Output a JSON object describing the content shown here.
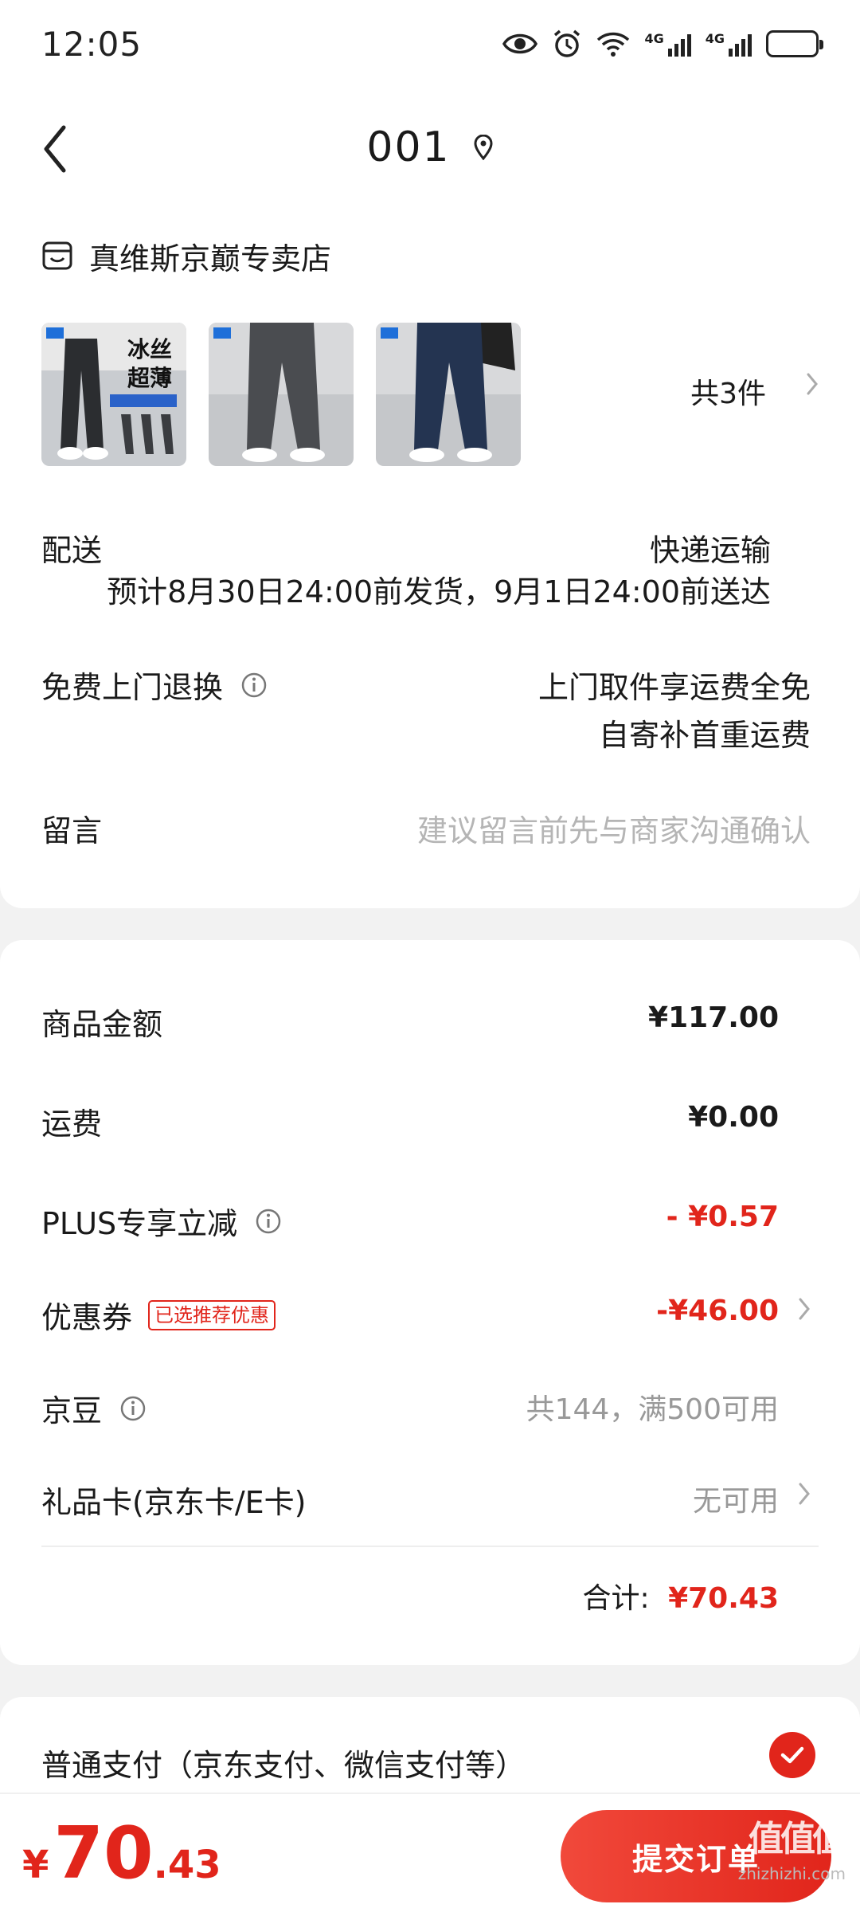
{
  "status": {
    "time": "12:05",
    "net1": "4G",
    "net2": "4G"
  },
  "nav": {
    "title": "001"
  },
  "shop": {
    "name": "真维斯京巅专卖店"
  },
  "products": {
    "thumb1_text_a": "冰丝",
    "thumb1_text_b": "超薄",
    "count": "共3件"
  },
  "delivery": {
    "label": "配送",
    "method": "快递运输",
    "eta": "预计8月30日24:00前发货，9月1日24:00前送达"
  },
  "returns": {
    "label": "免费上门退换",
    "line1": "上门取件享运费全免",
    "line2": "自寄补首重运费"
  },
  "message": {
    "label": "留言",
    "placeholder": "建议留言前先与商家沟通确认"
  },
  "summary": {
    "goods_label": "商品金额",
    "goods_value": "¥117.00",
    "shipping_label": "运费",
    "shipping_value": "¥0.00",
    "plus_label": "PLUS专享立减",
    "plus_value": "- ¥0.57",
    "coupon_label": "优惠券",
    "coupon_tag": "已选推荐优惠",
    "coupon_value": "-¥46.00",
    "jingdou_label": "京豆",
    "jingdou_value": "共144，满500可用",
    "giftcard_label": "礼品卡(京东卡/E卡)",
    "giftcard_value": "无可用",
    "total_label": "合计:",
    "total_value": "¥70.43"
  },
  "payment": {
    "label": "普通支付（京东支付、微信支付等）",
    "selected": true
  },
  "bottom": {
    "yen": "¥",
    "price_int": "70",
    "price_dec": ".43",
    "submit": "提交订单",
    "watermark": "zhizhizhi.com",
    "logo": "值值值"
  },
  "colors": {
    "accent": "#e1251b",
    "text": "#1a1a1a",
    "muted": "#999999",
    "bg": "#f2f2f2"
  }
}
